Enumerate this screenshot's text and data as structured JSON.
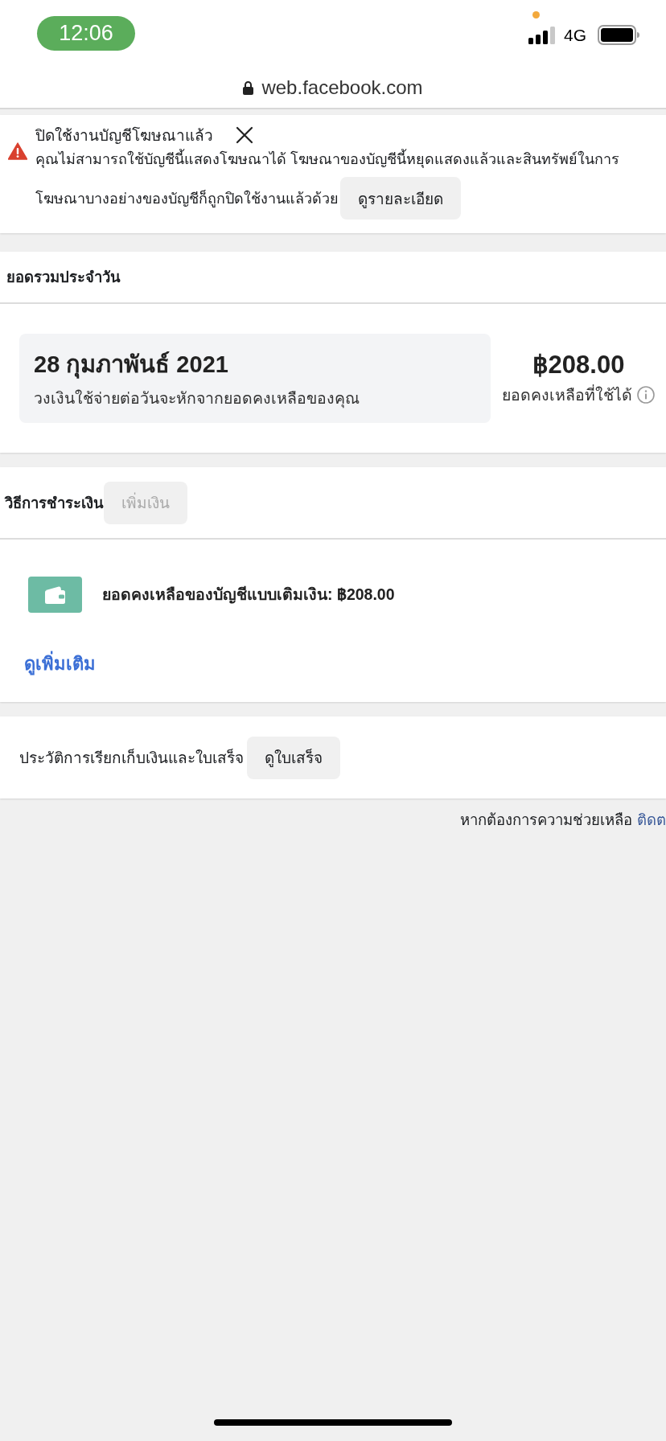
{
  "status_bar": {
    "time": "12:06",
    "network": "4G"
  },
  "address_bar": {
    "url": "web.facebook.com"
  },
  "alert": {
    "title": "ปิดใช้งานบัญชีโฆษณาแล้ว",
    "message_lines": [
      "คุณไม่สามารถใช้บัญชีนี้แสดงโฆษณาได้ โฆษณาของบัญชีนี้หยุดแสดงแล้วและสินทรัพย์ในการ",
      "โฆษณาบางอย่างของบัญชีก็ถูกปิดใช้งานแล้วด้วย"
    ],
    "button": "ดูรายละเอียด"
  },
  "daily_total": {
    "title": "ยอดรวมประจำวัน",
    "date": "28 กุมภาพันธ์ 2021",
    "note": "วงเงินใช้จ่ายต่อวันจะหักจากยอดคงเหลือของคุณ",
    "amount": "฿208.00",
    "amount_label": "ยอดคงเหลือที่ใช้ได้"
  },
  "payment": {
    "title": "วิธีการชำระเงิน",
    "button": {
      "label": "เพิ่มเงิน",
      "disabled": true
    },
    "balance": "ยอดคงเหลือของบัญชีแบบเติมเงิน: ฿208.00",
    "link": "ดูเพิ่มเติม"
  },
  "billing": {
    "title": "ประวัติการเรียกเก็บเงินและใบเสร็จ",
    "button": "ดูใบเสร็จ"
  },
  "footer": {
    "text": "หากต้องการความช่วยเหลือ",
    "link": "ติดต"
  }
}
